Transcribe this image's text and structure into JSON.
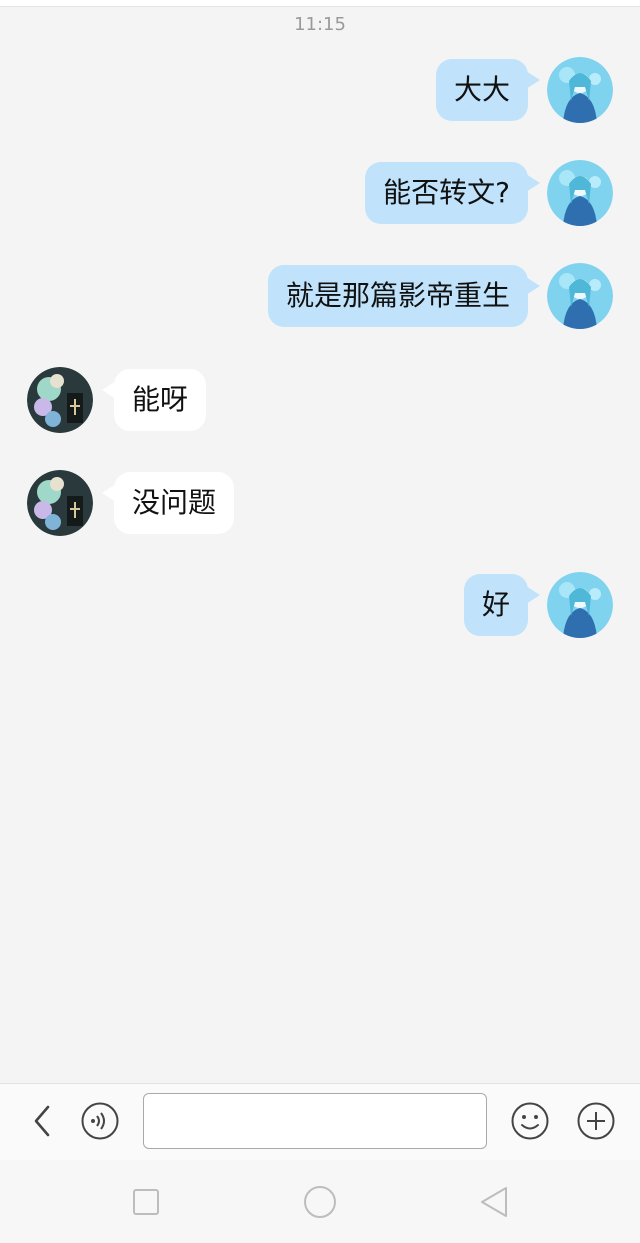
{
  "header": {
    "time": "11:15"
  },
  "messages": [
    {
      "side": "right",
      "text": "大大",
      "avatar": "avatar-self-icon"
    },
    {
      "side": "right",
      "text": "能否转文?",
      "avatar": "avatar-self-icon"
    },
    {
      "side": "right",
      "text": "就是那篇影帝重生",
      "avatar": "avatar-self-icon"
    },
    {
      "side": "left",
      "text": "能呀",
      "avatar": "avatar-other-icon"
    },
    {
      "side": "left",
      "text": "没问题",
      "avatar": "avatar-other-icon"
    },
    {
      "side": "right",
      "text": "好",
      "avatar": "avatar-self-icon"
    }
  ],
  "input_bar": {
    "text_value": "",
    "placeholder": "",
    "icons": [
      "back-chevron-icon",
      "voice-icon",
      "emoji-icon",
      "plus-icon"
    ]
  },
  "system_nav": {
    "icons": [
      "recent-apps-icon",
      "home-icon",
      "back-icon"
    ]
  },
  "colors": {
    "background": "#f4f4f4",
    "outgoing_bubble": "#c0e3fb",
    "incoming_bubble": "#ffffff",
    "timestamp": "#9a9a9a"
  }
}
